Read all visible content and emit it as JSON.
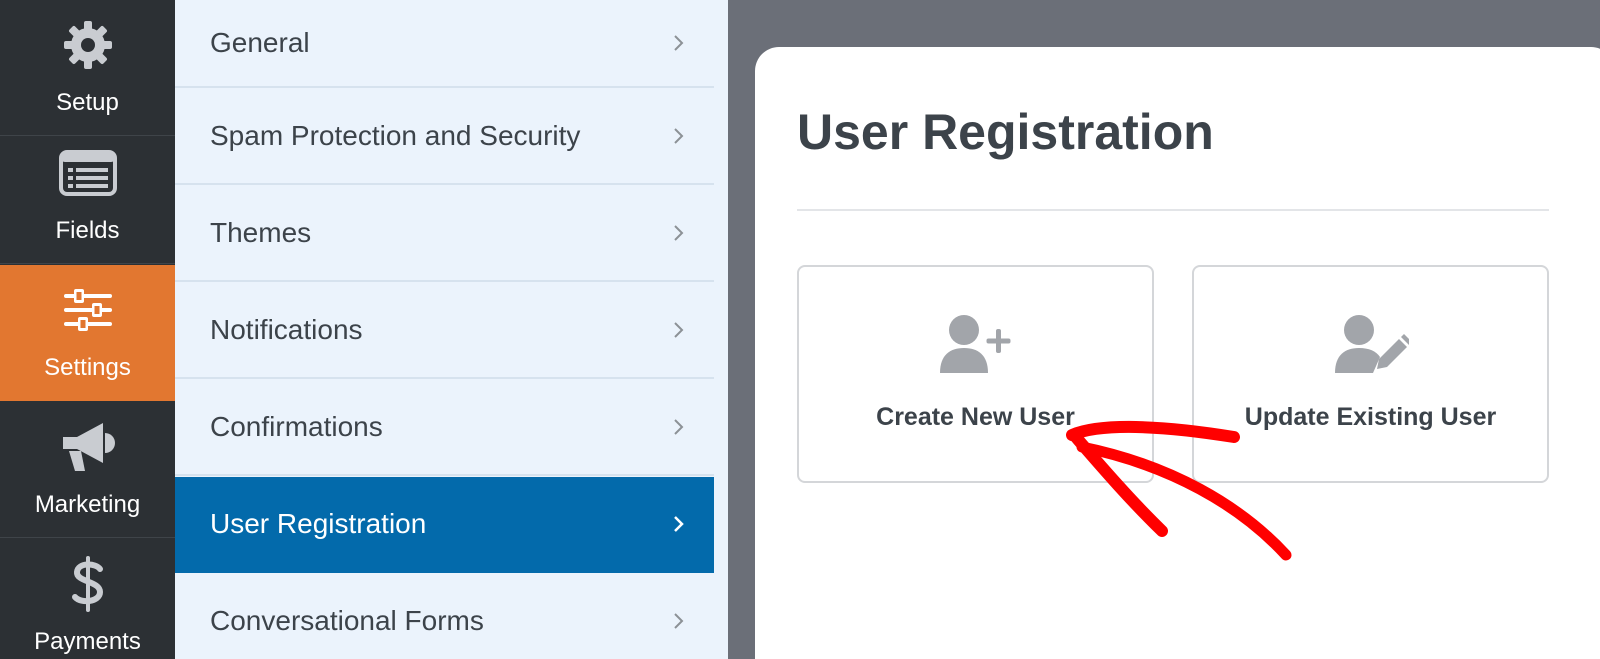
{
  "iconbar": {
    "items": [
      {
        "label": "Setup",
        "icon": "gear-icon"
      },
      {
        "label": "Fields",
        "icon": "fields-list-icon"
      },
      {
        "label": "Settings",
        "icon": "sliders-icon",
        "active": true
      },
      {
        "label": "Marketing",
        "icon": "megaphone-icon"
      },
      {
        "label": "Payments",
        "icon": "dollar-icon"
      }
    ]
  },
  "menu": {
    "items": [
      {
        "label": "General"
      },
      {
        "label": "Spam Protection and Security"
      },
      {
        "label": "Themes"
      },
      {
        "label": "Notifications"
      },
      {
        "label": "Confirmations"
      },
      {
        "label": "User Registration",
        "active": true
      },
      {
        "label": "Conversational Forms"
      }
    ]
  },
  "main": {
    "title": "User Registration",
    "options": [
      {
        "label": "Create New User",
        "icon": "user-add-icon"
      },
      {
        "label": "Update Existing User",
        "icon": "user-edit-icon"
      }
    ]
  },
  "colors": {
    "accent": "#e27730",
    "active_menu": "#036aab",
    "iconbar_bg": "#2c3034",
    "annotation_arrow": "#ff0000"
  }
}
